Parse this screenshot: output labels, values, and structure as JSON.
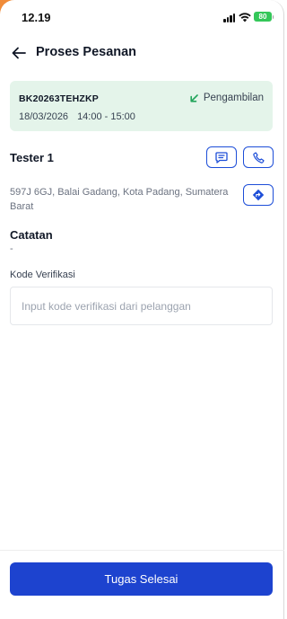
{
  "status_bar": {
    "time": "12.19",
    "battery": "80"
  },
  "header": {
    "title": "Proses Pesanan"
  },
  "order": {
    "code": "BK20263TEHZKP",
    "type": "Pengambilan",
    "date": "18/03/2026",
    "time_range": "14:00 - 15:00"
  },
  "customer": {
    "name": "Tester 1",
    "address": "597J 6GJ, Balai Gadang, Kota Padang, Sumatera Barat"
  },
  "notes": {
    "title": "Catatan",
    "value": "-"
  },
  "verification": {
    "label": "Kode Verifikasi",
    "value": "",
    "placeholder": "Input kode verifikasi dari pelanggan"
  },
  "footer": {
    "submit_label": "Tugas Selesai"
  },
  "colors": {
    "primary": "#1d43cf",
    "card_bg": "#e4f4ea",
    "pickup_arrow": "#22a55b",
    "battery": "#34c759"
  },
  "icons": [
    "back-arrow-icon",
    "pickup-arrow-icon",
    "chat-icon",
    "phone-icon",
    "navigation-icon",
    "signal-icon",
    "wifi-icon",
    "battery-icon"
  ]
}
